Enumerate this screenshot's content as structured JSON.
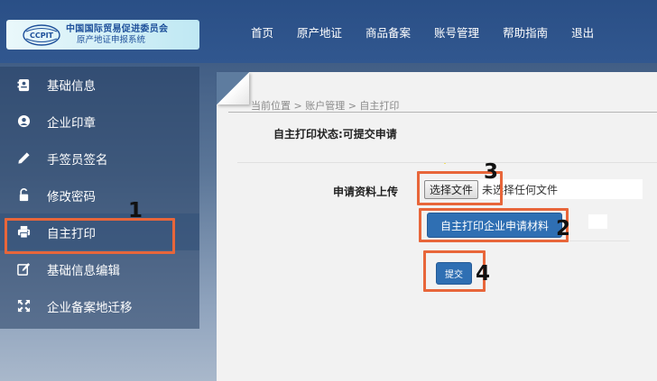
{
  "header": {
    "logo_mark_text": "CCPIT",
    "logo_line1": "中国国际贸易促进委员会",
    "logo_line2": "原产地证申报系统",
    "nav": [
      "首页",
      "原产地证",
      "商品备案",
      "账号管理",
      "帮助指南",
      "退出"
    ]
  },
  "sidebar": {
    "items": [
      {
        "label": "基础信息",
        "icon": "id-card-icon"
      },
      {
        "label": "企业印章",
        "icon": "stamp-icon"
      },
      {
        "label": "手签员签名",
        "icon": "pen-icon"
      },
      {
        "label": "修改密码",
        "icon": "unlock-icon"
      },
      {
        "label": "自主打印",
        "icon": "printer-icon"
      },
      {
        "label": "基础信息编辑",
        "icon": "edit-icon"
      },
      {
        "label": "企业备案地迁移",
        "icon": "move-icon"
      }
    ],
    "active_index": 4
  },
  "main": {
    "breadcrumb": "当前位置 > 账户管理 > 自主打印",
    "status_text": "自主打印状态:可提交申请",
    "upload_label": "申请资料上传",
    "choose_file_label": "选择文件",
    "no_file_text": "未选择任何文件",
    "print_button_label": "自主打印企业申请材料",
    "submit_button_label": "提交"
  },
  "annotations": {
    "numbers": [
      "1",
      "2",
      "3",
      "4"
    ],
    "color": "#e8663a"
  },
  "colors": {
    "header_bg": "#2a4f86",
    "button_blue": "#2f6fb3",
    "annotation_orange": "#e8663a"
  }
}
